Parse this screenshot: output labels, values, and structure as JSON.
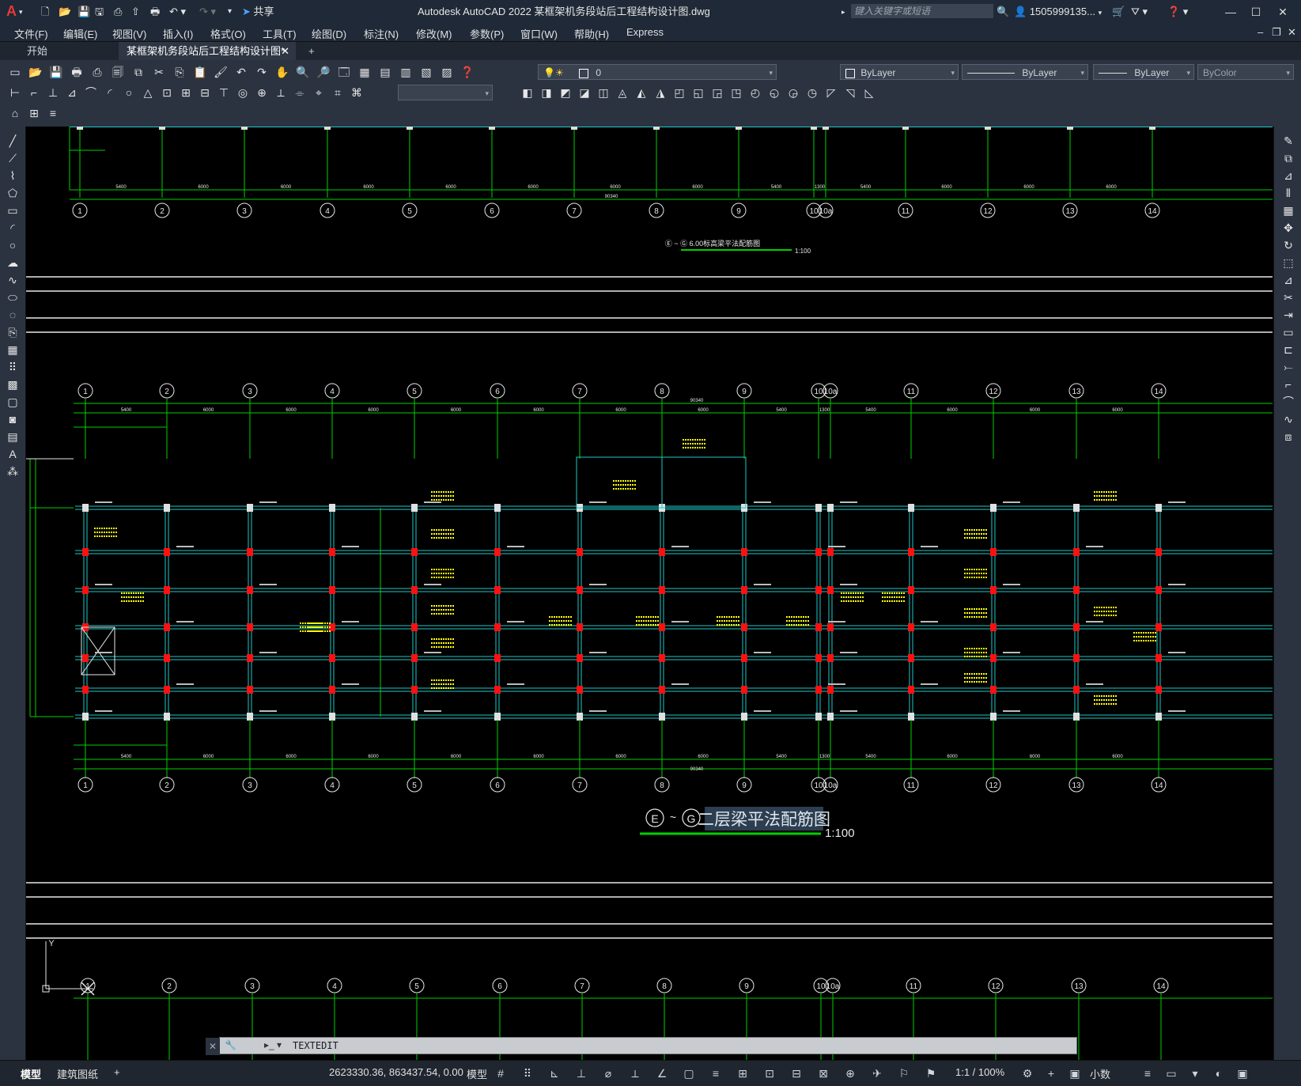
{
  "app": {
    "title": "Autodesk AutoCAD 2022    某框架机务段站后工程结构设计图.dwg",
    "share_label": "共享",
    "search_placeholder": "键入关键字或短语",
    "user": "1505999135...",
    "logo_letter": "A"
  },
  "menu": [
    "文件(F)",
    "编辑(E)",
    "视图(V)",
    "插入(I)",
    "格式(O)",
    "工具(T)",
    "绘图(D)",
    "标注(N)",
    "修改(M)",
    "参数(P)",
    "窗口(W)",
    "帮助(H)",
    "Express"
  ],
  "tabs": [
    {
      "label": "开始",
      "active": false
    },
    {
      "label": "某框架机务段站后工程结构设计图*",
      "active": true
    }
  ],
  "properties": {
    "layer_value": "0",
    "color": "ByLayer",
    "linetype": "ByLayer",
    "lineweight": "ByLayer",
    "plotstyle": "ByColor"
  },
  "drawing": {
    "axes": [
      "1",
      "2",
      "3",
      "4",
      "5",
      "6",
      "7",
      "8",
      "9",
      "10",
      "10a",
      "11",
      "12",
      "13",
      "14"
    ],
    "top_title_prefix": "Ⓔ ~ Ⓖ",
    "top_title": "6.00标高梁平法配筋图",
    "top_scale": "1:100",
    "main_title_from": "E",
    "main_title_to": "G",
    "main_title": "二层梁平法配筋图",
    "main_scale": "1:100",
    "spans": [
      "5400",
      "6000",
      "6000",
      "6000",
      "6000",
      "6000",
      "6000",
      "6000",
      "5400",
      "1300",
      "5400",
      "6000",
      "6000",
      "6000"
    ],
    "total_length": "90340",
    "ucs_y": "Y"
  },
  "command": {
    "text": "TEXTEDIT"
  },
  "status": {
    "layout_tabs": [
      "模型",
      "建筑图纸"
    ],
    "coords": "2623330.36, 863437.54, 0.00",
    "model": "模型",
    "scale": "1:1 / 100%",
    "units": "小数"
  },
  "colors": {
    "green": "#00d000",
    "cyan": "#1ec8c8",
    "yellow": "#ffff00",
    "red": "#ff1010",
    "white": "#e8e8e8"
  }
}
